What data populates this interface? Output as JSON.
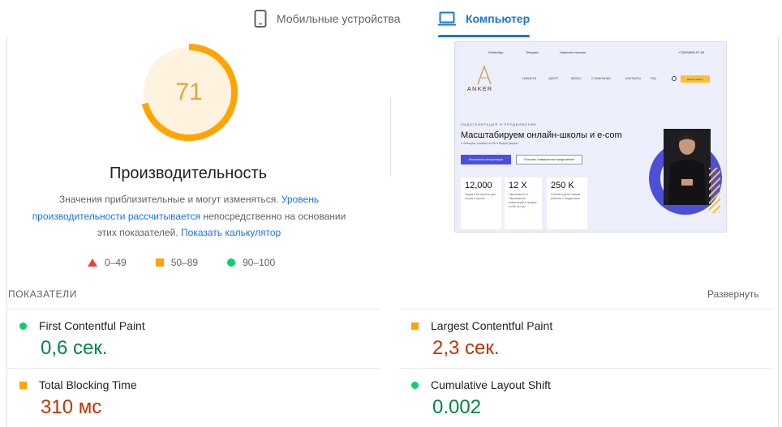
{
  "tabs": {
    "mobile_label": "Мобильные устройства",
    "desktop_label": "Компьютер"
  },
  "performance": {
    "score": "71",
    "score_fraction": 0.71,
    "title": "Производительность",
    "desc_part1": "Значения приблизительные и могут изменяться.",
    "desc_link1": "Уровень производительности рассчитывается",
    "desc_part2": "непосредственно на основании этих показателей.",
    "desc_link2": "Показать калькулятор",
    "colors": {
      "gauge": "#ffa400",
      "gauge_bg": "#fff3e0",
      "score_text": "#e8a23b"
    }
  },
  "legend": {
    "poor": "0–49",
    "average": "50–89",
    "good": "90–100"
  },
  "thumbnail": {
    "topbar": [
      "WhatsApp",
      "Telegram",
      "Написать письмо",
      "+7(999)999-07-65"
    ],
    "logo": "ANKER",
    "nav": [
      "НОВОСТИ",
      "ЦЕНТР",
      "КЕЙСЫ",
      "О КОМПАНИИ",
      "КОНТАКТЫ",
      "FAQ"
    ],
    "cta": "Начать работу",
    "subtitle": "ЛИДОГЕНЕРАЦИЯ И ПРОДВИЖЕНИЕ",
    "headline": "Масштабируем онлайн-школы и e-com",
    "small": "с помощью трафика из ВК и Яндекс.Директ",
    "btn1": "Бесплатная консультация",
    "btn2": "Получить коммерческое предложение",
    "stats": [
      {
        "n": "12,000",
        "t": "Лидов в Интернете для нишах в школе"
      },
      {
        "n": "12 X",
        "t": "Окупаемость в Окупаемость инвестиций в трафик из ВК за год"
      },
      {
        "n": "250 K",
        "t": "Рублей в день Нашим работал с бюджетами"
      }
    ]
  },
  "metrics": {
    "section_label": "ПОКАЗАТЕЛИ",
    "expand_label": "Развернуть",
    "items": [
      {
        "name": "First Contentful Paint",
        "value": "0,6 сек."
      },
      {
        "name": "Largest Contentful Paint",
        "value": "2,3 сек."
      },
      {
        "name": "Total Blocking Time",
        "value": "310 мс"
      },
      {
        "name": "Cumulative Layout Shift",
        "value": "0.002"
      }
    ]
  }
}
